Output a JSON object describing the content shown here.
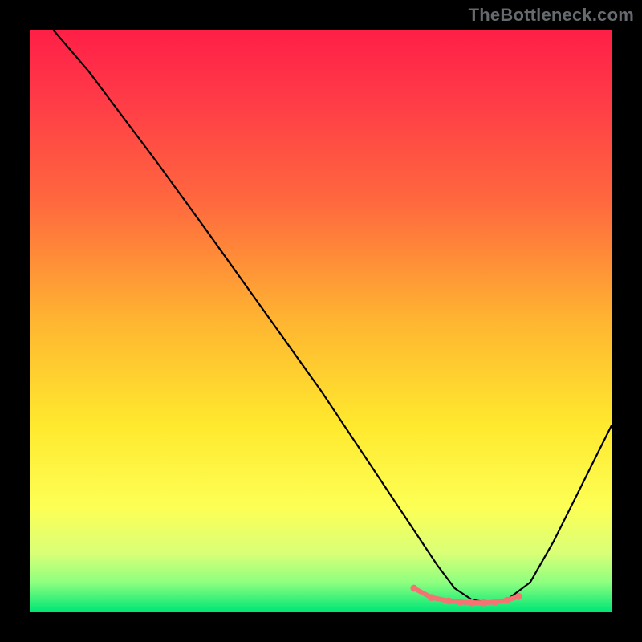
{
  "watermark": "TheBottleneck.com",
  "chart_data": {
    "type": "line",
    "title": "",
    "xlabel": "",
    "ylabel": "",
    "xlim": [
      0,
      100
    ],
    "ylim": [
      0,
      100
    ],
    "background_gradient": {
      "stops": [
        {
          "offset": 0.0,
          "color": "#ff1f47"
        },
        {
          "offset": 0.12,
          "color": "#ff3b47"
        },
        {
          "offset": 0.3,
          "color": "#ff6a3e"
        },
        {
          "offset": 0.5,
          "color": "#ffb531"
        },
        {
          "offset": 0.68,
          "color": "#ffe92e"
        },
        {
          "offset": 0.82,
          "color": "#fdff55"
        },
        {
          "offset": 0.9,
          "color": "#d9ff77"
        },
        {
          "offset": 0.95,
          "color": "#8eff7f"
        },
        {
          "offset": 1.0,
          "color": "#00e676"
        }
      ]
    },
    "series": [
      {
        "name": "curve",
        "color": "#000000",
        "width": 2.2,
        "x": [
          4,
          10,
          16,
          22,
          30,
          40,
          50,
          60,
          66,
          70,
          73,
          76,
          79,
          82,
          86,
          90,
          94,
          98,
          100
        ],
        "y": [
          100,
          93,
          85,
          77,
          66,
          52,
          38,
          23,
          14,
          8,
          4,
          2,
          1.5,
          2,
          5,
          12,
          20,
          28,
          32
        ]
      },
      {
        "name": "highlight",
        "color": "#f57373",
        "marker": "circle",
        "marker_size": 4.4,
        "line_width": 6,
        "x": [
          66,
          69,
          72,
          74,
          76,
          78,
          80,
          82,
          84
        ],
        "y": [
          4,
          2.4,
          1.8,
          1.6,
          1.5,
          1.5,
          1.6,
          1.9,
          2.6
        ]
      }
    ]
  }
}
